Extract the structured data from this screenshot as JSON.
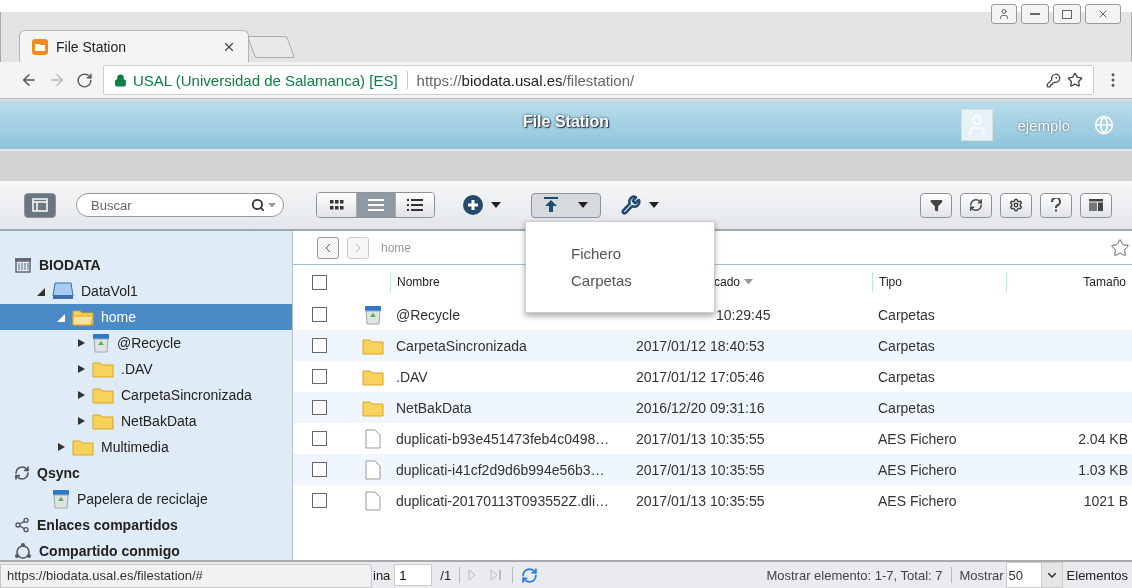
{
  "browser": {
    "tab": {
      "title": "File Station",
      "selected": true
    },
    "address": {
      "site_identity": "USAL (Universidad de Salamanca) [ES]",
      "url_scheme": "https://",
      "url_host": "biodata.usal.es",
      "url_path": "/filestation/"
    }
  },
  "header": {
    "title": "File Station",
    "user": "ejemplo"
  },
  "toolbar": {
    "search": {
      "placeholder": "Buscar"
    },
    "view_modes": [
      {
        "kind": "grid",
        "selected": false
      },
      {
        "kind": "list",
        "selected": true
      },
      {
        "kind": "details",
        "selected": false
      }
    ],
    "upload_open": true
  },
  "upload_menu": {
    "items": [
      "Fichero",
      "Carpetas"
    ]
  },
  "sidebar": {
    "tree": [
      {
        "label": "BIODATA",
        "kind": "nas",
        "selected": false,
        "children": [
          {
            "label": "DataVol1",
            "kind": "volume",
            "selected": false,
            "expanded": true,
            "children": [
              {
                "label": "home",
                "kind": "folder-open",
                "selected": true,
                "expanded": true,
                "children": [
                  {
                    "label": "@Recycle",
                    "kind": "recycle",
                    "selected": false,
                    "expanded": false
                  },
                  {
                    "label": ".DAV",
                    "kind": "folder",
                    "selected": false,
                    "expanded": false
                  },
                  {
                    "label": "CarpetaSincronizada",
                    "kind": "folder",
                    "selected": false,
                    "expanded": false
                  },
                  {
                    "label": "NetBakData",
                    "kind": "folder",
                    "selected": false,
                    "expanded": false
                  }
                ]
              },
              {
                "label": "Multimedia",
                "kind": "folder",
                "selected": false,
                "expanded": false
              }
            ]
          }
        ]
      },
      {
        "label": "Qsync",
        "kind": "sync",
        "selected": false,
        "children": [
          {
            "label": "Papelera de reciclaje",
            "kind": "recycle",
            "selected": false
          }
        ]
      },
      {
        "label": "Enlaces compartidos",
        "kind": "share",
        "selected": false
      },
      {
        "label": "Compartido conmigo",
        "kind": "shared",
        "selected": false
      }
    ]
  },
  "breadcrumb": {
    "path": "home",
    "forward_disabled": true
  },
  "table": {
    "select_all": {
      "checked": false
    },
    "columns": [
      {
        "label": "Nombre",
        "sorted": false
      },
      {
        "label": "cado",
        "sorted": true,
        "cut": true
      },
      {
        "label": "Tipo",
        "sorted": false
      },
      {
        "label": "Tamaño",
        "sorted": false
      }
    ],
    "rows": [
      {
        "kind": "recycle",
        "name": "@Recycle",
        "modified": "10:29:45",
        "modified_cut": true,
        "type": "Carpetas",
        "checked": false
      },
      {
        "kind": "folder",
        "name": "CarpetaSincronizada",
        "modified": "2017/01/12 18:40:53",
        "type": "Carpetas",
        "checked": false
      },
      {
        "kind": "folder",
        "name": ".DAV",
        "modified": "2017/01/12 17:05:46",
        "type": "Carpetas",
        "checked": false
      },
      {
        "kind": "folder",
        "name": "NetBakData",
        "modified": "2016/12/20 09:31:16",
        "type": "Carpetas",
        "checked": false
      },
      {
        "kind": "file",
        "name": "duplicati-b93e451473feb4c0498…",
        "modified": "2017/01/13 10:35:55",
        "type": "AES Fichero",
        "size": "2.04 KB",
        "checked": false
      },
      {
        "kind": "file",
        "name": "duplicati-i41cf2d9d6b994e56b3…",
        "modified": "2017/01/13 10:35:55",
        "type": "AES Fichero",
        "size": "1.03 KB",
        "checked": false
      },
      {
        "kind": "file",
        "name": "duplicati-20170113T093552Z.dli…",
        "modified": "2017/01/13 10:35:55",
        "type": "AES Fichero",
        "size": "1021 B",
        "checked": false
      }
    ]
  },
  "pager": {
    "label": "ina",
    "page": "1",
    "total_pages": "/1",
    "summary": "Mostrar elemento: 1-7, Total: 7",
    "show_label": "Mostrar",
    "per_page": "50",
    "per_page_unit": "Elementos"
  },
  "status_bubble": "https://biodata.usal.es/filestation/#"
}
